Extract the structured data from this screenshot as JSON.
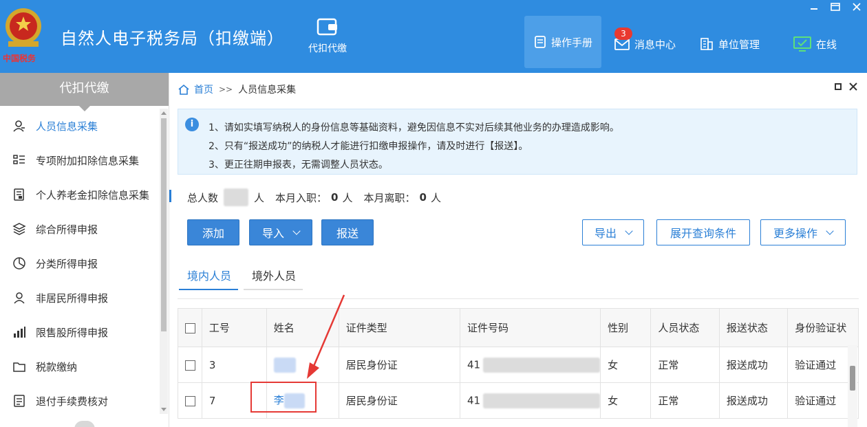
{
  "app": {
    "logo_text": "中国税务",
    "title": "自然人电子税务局（扣缴端）",
    "nav_daikou": "代扣代缴",
    "manual": "操作手册",
    "messages": "消息中心",
    "messages_badge": "3",
    "unit_mgmt": "单位管理",
    "online": "在线"
  },
  "sidebar": {
    "header": "代扣代缴",
    "items": [
      {
        "label": "人员信息采集",
        "icon": "person-icon"
      },
      {
        "label": "专项附加扣除信息采集",
        "icon": "list-icon"
      },
      {
        "label": "个人养老金扣除信息采集",
        "icon": "document-icon"
      },
      {
        "label": "综合所得申报",
        "icon": "layers-icon"
      },
      {
        "label": "分类所得申报",
        "icon": "pie-icon"
      },
      {
        "label": "非居民所得申报",
        "icon": "user-icon"
      },
      {
        "label": "限售股所得申报",
        "icon": "bar-chart-icon"
      },
      {
        "label": "税款缴纳",
        "icon": "folder-icon"
      },
      {
        "label": "退付手续费核对",
        "icon": "checklist-icon"
      }
    ]
  },
  "breadcrumb": {
    "home": "首页",
    "sep": ">>",
    "current": "人员信息采集"
  },
  "notice": {
    "lines": [
      "1、请如实填写纳税人的身份信息等基础资料，避免因信息不实对后续其他业务的办理造成影响。",
      "2、只有“报送成功”的纳税人才能进行扣缴申报操作，请及时进行【报送】。",
      "3、更正往期申报表，无需调整人员状态。"
    ]
  },
  "stats": {
    "total_label": "总人数",
    "total_unit": "人",
    "month_in_label": "本月入职：",
    "month_in_value": "0",
    "month_in_unit": "人",
    "month_out_label": "本月离职：",
    "month_out_value": "0",
    "month_out_unit": "人"
  },
  "toolbar": {
    "add": "添加",
    "import": "导入",
    "submit": "报送",
    "export": "导出",
    "expand_query": "展开查询条件",
    "more": "更多操作"
  },
  "tabs": [
    "境内人员",
    "境外人员"
  ],
  "table": {
    "columns": [
      "工号",
      "姓名",
      "证件类型",
      "证件号码",
      "性别",
      "人员状态",
      "报送状态",
      "身份验证状"
    ],
    "rows": [
      {
        "id": "3",
        "name": "",
        "id_type": "居民身份证",
        "id_no": "41",
        "gender": "女",
        "status": "正常",
        "submit_status": "报送成功",
        "verify": "验证通过"
      },
      {
        "id": "7",
        "name": "李",
        "id_type": "居民身份证",
        "id_no": "41",
        "gender": "女",
        "status": "正常",
        "submit_status": "报送成功",
        "verify": "验证通过"
      }
    ]
  },
  "colors": {
    "header_bg": "#2f8ce0",
    "accent": "#2a7fd6",
    "annotation": "#e53935"
  }
}
